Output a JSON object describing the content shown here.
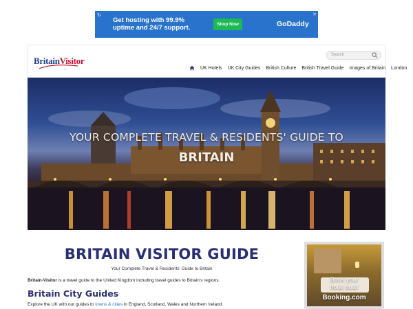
{
  "ad_top": {
    "info_icon": "info-icon",
    "close_icon": "close-icon",
    "text": "Get hosting with 99.9%\nuptime and 24/7 support.",
    "button": "Shop Now",
    "brand": "GoDaddy",
    "color_bg": "#2a73cc",
    "color_button": "#1db954"
  },
  "header": {
    "logo_part1": "Britain",
    "logo_part2": "Visitor",
    "search_placeholder": "Search",
    "nav": [
      "UK Hotels",
      "UK City Guides",
      "British Culture",
      "British Travel Guide",
      "Images of Britain",
      "London"
    ]
  },
  "hero": {
    "line1": "YOUR COMPLETE TRAVEL & RESIDENTS' GUIDE TO",
    "line2": "BRITAIN"
  },
  "main": {
    "title": "BRITAIN VISITOR GUIDE",
    "subtitle": "Your Complete Travel & Residents' Guide to Britain",
    "intro_bold": "Britain-Visitor",
    "intro_rest": " is a travel guide to the United Kingdom including travel guides to Britain's regions.",
    "section_title": "Britain City Guides",
    "explore_before": "Explore the UK with our guides to ",
    "explore_link": "towns & cities",
    "explore_after": " in England, Scotland, Wales and Northern Ireland."
  },
  "ad_side": {
    "line1": "Book your",
    "line2": "hotel now!",
    "brand": "Booking.com"
  },
  "colors": {
    "heading": "#2a2f73",
    "logo_blue": "#1e3f8f",
    "logo_red": "#c8102e",
    "link": "#2a73cc"
  }
}
